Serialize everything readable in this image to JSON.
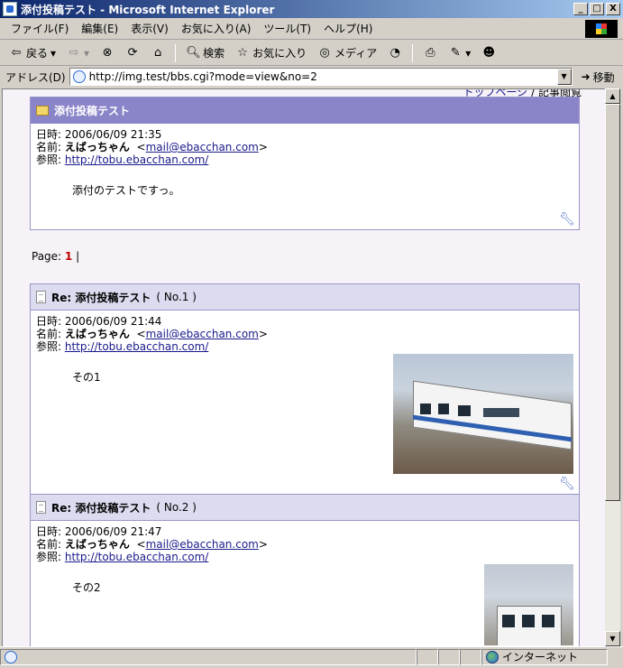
{
  "window": {
    "title": "添付投稿テスト - Microsoft Internet Explorer",
    "minimize": "_",
    "maximize": "□",
    "close": "X"
  },
  "menu": [
    "ファイル(F)",
    "編集(E)",
    "表示(V)",
    "お気に入り(A)",
    "ツール(T)",
    "ヘルプ(H)"
  ],
  "toolbar": {
    "back": "戻る",
    "search": "検索",
    "favorites": "お気に入り",
    "media": "メディア"
  },
  "address": {
    "label": "アドレス(D)",
    "url": "http://img.test/bbs.cgi?mode=view&no=2",
    "go": "移動"
  },
  "top_links": {
    "link": "トップページ",
    "separator": " / ",
    "current": "記事閲覧"
  },
  "main_post": {
    "title": "添付投稿テスト",
    "date_label": "日時:",
    "date": "2006/06/09 21:35",
    "name_label": "名前:",
    "author": "えばっちゃん",
    "email": "mail@ebacchan.com",
    "ref_label": "参照:",
    "url": "http://tobu.ebacchan.com/",
    "message": "添付のテストですっ。"
  },
  "pager": {
    "label": "Page:",
    "current": "1",
    "sep": "|"
  },
  "replies": [
    {
      "title": "Re: 添付投稿テスト",
      "number": "( No.1 )",
      "date_label": "日時:",
      "date": "2006/06/09 21:44",
      "name_label": "名前:",
      "author": "えばっちゃん",
      "email": "mail@ebacchan.com",
      "ref_label": "参照:",
      "url": "http://tobu.ebacchan.com/",
      "message": "その1"
    },
    {
      "title": "Re: 添付投稿テスト",
      "number": "( No.2 )",
      "date_label": "日時:",
      "date": "2006/06/09 21:47",
      "name_label": "名前:",
      "author": "えばっちゃん",
      "email": "mail@ebacchan.com",
      "ref_label": "参照:",
      "url": "http://tobu.ebacchan.com/",
      "message": "その2"
    }
  ],
  "status": {
    "zone": "インターネット"
  }
}
